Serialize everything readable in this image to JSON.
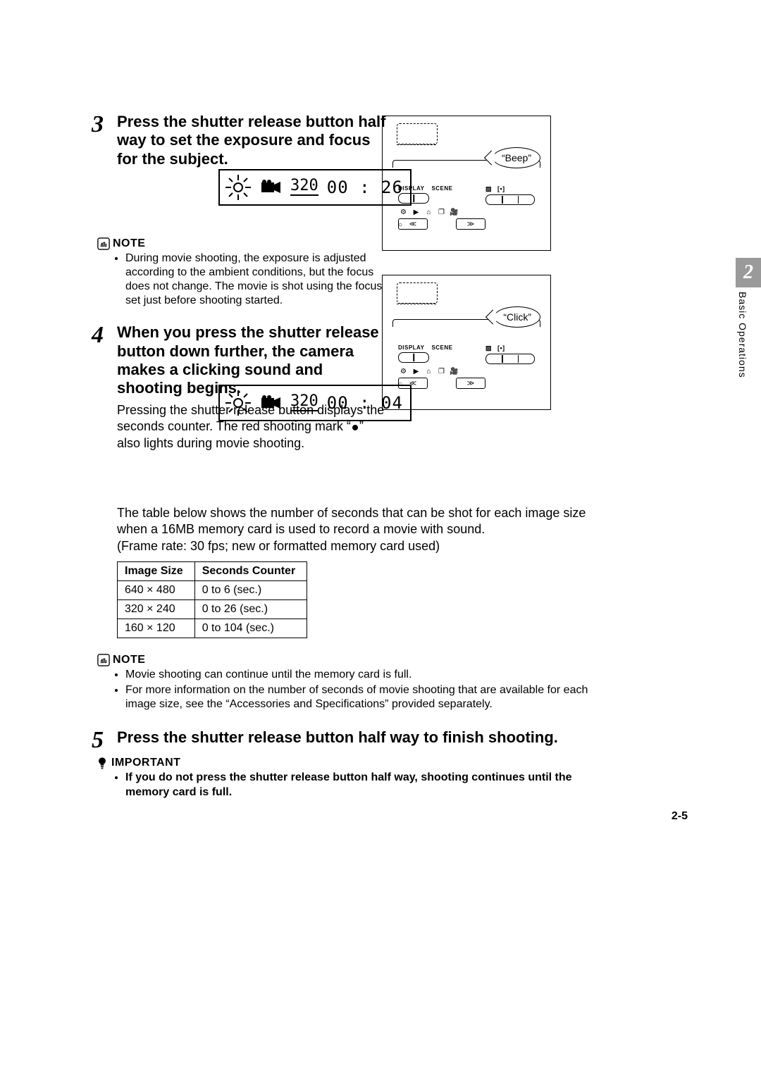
{
  "side": {
    "chapter_number": "2",
    "chapter_title": "Basic Operations"
  },
  "lcd": {
    "mode": "320",
    "time_before": "00 : 26",
    "time_during": "00 : 04"
  },
  "cam_speech": {
    "half_press": "“Beep”",
    "full_press": "“Click”"
  },
  "cam_labels": {
    "display": "DISPLAY",
    "scene": "SCENE"
  },
  "step3": {
    "num": "3",
    "title": "Press the shutter release button half way to set the exposure and focus for the subject.",
    "note_label": "NOTE",
    "note_items": [
      "During movie shooting, the exposure is adjusted according to the ambient conditions, but the focus does not change. The movie is shot using the focus set just before shooting started."
    ]
  },
  "step4": {
    "num": "4",
    "title": "When you press the shutter release button down further, the camera makes a clicking sound and shooting begins.",
    "body_line1": "Pressing the shutter release button displays the seconds counter. The red shooting mark “",
    "body_line2": "” also lights during movie shooting.",
    "table_intro1": "The table below shows the number of seconds that can be shot for each image size when a 16MB memory card is used to record a movie with sound.",
    "table_intro2": "(Frame rate: 30 fps; new or formatted memory card used)",
    "note_label": "NOTE",
    "note_items": [
      "Movie shooting can continue until the memory card is full.",
      "For more information on the number of seconds of movie shooting that are available for each image size, see the “Accessories and Specifications” provided separately."
    ]
  },
  "table": {
    "headers": [
      "Image Size",
      "Seconds Counter"
    ],
    "rows": [
      [
        "640 × 480",
        "0 to 6 (sec.)"
      ],
      [
        "320 × 240",
        "0 to 26 (sec.)"
      ],
      [
        "160 × 120",
        "0 to 104 (sec.)"
      ]
    ]
  },
  "step5": {
    "num": "5",
    "title": "Press the shutter release button half way to finish shooting.",
    "imp_label": "IMPORTANT",
    "imp_items": [
      "If you do not press the shutter release button half way, shooting continues until the memory card is full."
    ]
  },
  "page_number": "2-5"
}
